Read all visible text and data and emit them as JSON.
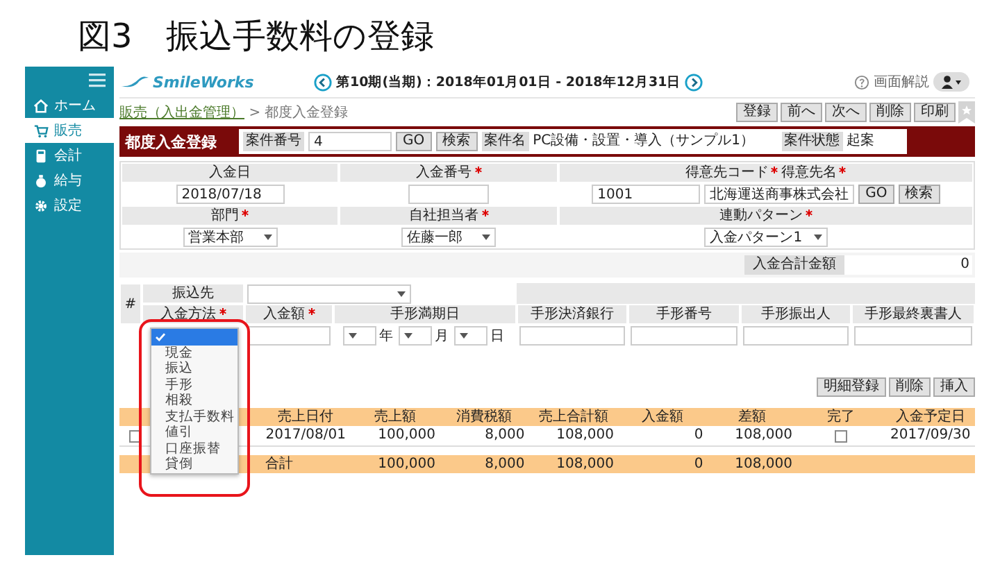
{
  "slide_title": "図3　振込手数料の登録",
  "sidebar": {
    "items": [
      {
        "label": "ホーム",
        "selected": false
      },
      {
        "label": "販売",
        "selected": true
      },
      {
        "label": "会計",
        "selected": false
      },
      {
        "label": "給与",
        "selected": false
      },
      {
        "label": "設定",
        "selected": false
      }
    ]
  },
  "header": {
    "logo": "SmileWorks",
    "period": "第10期(当期)：2018年01月01日 - 2018年12月31日",
    "help": "画面解説"
  },
  "breadcrumb": {
    "link": "販売（入出金管理）",
    "current": "> 都度入金登録"
  },
  "toolbar": [
    "登録",
    "前へ",
    "次へ",
    "削除",
    "印刷"
  ],
  "title_bar": {
    "title": "都度入金登録",
    "case_no_label": "案件番号",
    "case_no": "4",
    "go": "GO",
    "search": "検索",
    "case_name_label": "案件名",
    "case_name": "PC設備・設置・導入（サンプル1）",
    "status_label": "案件状態",
    "status": "起案"
  },
  "form": {
    "rows": [
      {
        "cells": [
          {
            "label": "入金日",
            "required": false,
            "fields": [
              {
                "kind": "input",
                "value": "2018/07/18"
              }
            ]
          },
          {
            "label": "入金番号",
            "required": true,
            "fields": [
              {
                "kind": "input"
              }
            ]
          },
          {
            "label": "得意先コード",
            "required": true,
            "label2": "得意先名",
            "fields": [
              {
                "kind": "input",
                "value": "1001"
              },
              {
                "kind": "input",
                "value": "北海運送商事株式会社"
              },
              {
                "kind": "button",
                "value": "GO"
              },
              {
                "kind": "button",
                "value": "検索"
              }
            ]
          }
        ]
      },
      {
        "cells": [
          {
            "label": "部門",
            "required": true,
            "fields": [
              {
                "kind": "select",
                "value": "営業本部"
              }
            ]
          },
          {
            "label": "自社担当者",
            "required": true,
            "fields": [
              {
                "kind": "select",
                "value": "佐藤一郎"
              }
            ]
          },
          {
            "label": "連動パターン",
            "required": true,
            "fields": [
              {
                "kind": "select",
                "value": "入金パターン1"
              }
            ]
          }
        ]
      }
    ]
  },
  "total": {
    "label": "入金合計金額",
    "value": "0"
  },
  "detail": {
    "number_header": "#",
    "payee_label": "振込先",
    "columns": [
      {
        "label": "入金方法",
        "required": true
      },
      {
        "label": "入金額",
        "required": true
      },
      {
        "label": "手形満期日",
        "required": false
      },
      {
        "label": "手形決済銀行",
        "required": false
      },
      {
        "label": "手形番号",
        "required": false
      },
      {
        "label": "手形振出人",
        "required": false
      },
      {
        "label": "手形最終裏書人",
        "required": false
      }
    ],
    "date_units": [
      "年",
      "月",
      "日"
    ],
    "dropdown": [
      {
        "selected": true
      },
      {
        "label": "現金",
        "selected": false
      },
      {
        "label": "振込",
        "selected": false
      },
      {
        "label": "手形",
        "selected": false
      },
      {
        "label": "相殺",
        "selected": false
      },
      {
        "label": "支払手数料",
        "selected": false
      },
      {
        "label": "値引",
        "selected": false
      },
      {
        "label": "口座振替",
        "selected": false
      },
      {
        "label": "貸倒",
        "selected": false
      }
    ],
    "buttons": [
      "明細登録",
      "削除",
      "挿入"
    ]
  },
  "table": {
    "columns": [
      "売上日付",
      "売上額",
      "消費税額",
      "売上合計額",
      "入金額",
      "差額",
      "完了",
      "入金予定日"
    ],
    "rows": [
      {
        "checked": false,
        "date": "2017/08/01",
        "sales": "100,000",
        "tax": "8,000",
        "total": "108,000",
        "paid": "0",
        "diff": "108,000",
        "done": false,
        "due": "2017/09/30"
      }
    ],
    "footer": {
      "label": "合計",
      "sales": "100,000",
      "tax": "8,000",
      "total": "108,000",
      "paid": "0",
      "diff": "108,000"
    }
  }
}
